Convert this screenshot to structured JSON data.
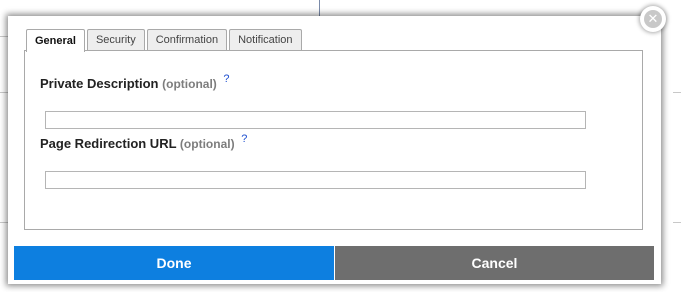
{
  "dialog": {
    "tabs": [
      {
        "label": "General",
        "active": true
      },
      {
        "label": "Security",
        "active": false
      },
      {
        "label": "Confirmation",
        "active": false
      },
      {
        "label": "Notification",
        "active": false
      }
    ],
    "fields": [
      {
        "label": "Private Description",
        "optional": "(optional)",
        "help": "?",
        "value": ""
      },
      {
        "label": "Page Redirection URL",
        "optional": "(optional)",
        "help": "?",
        "value": ""
      }
    ],
    "close_icon": "close-icon",
    "done_label": "Done",
    "cancel_label": "Cancel"
  },
  "colors": {
    "done": "#0d7fe0",
    "cancel": "#6e6e6e",
    "help_link": "#1e4fd0"
  }
}
